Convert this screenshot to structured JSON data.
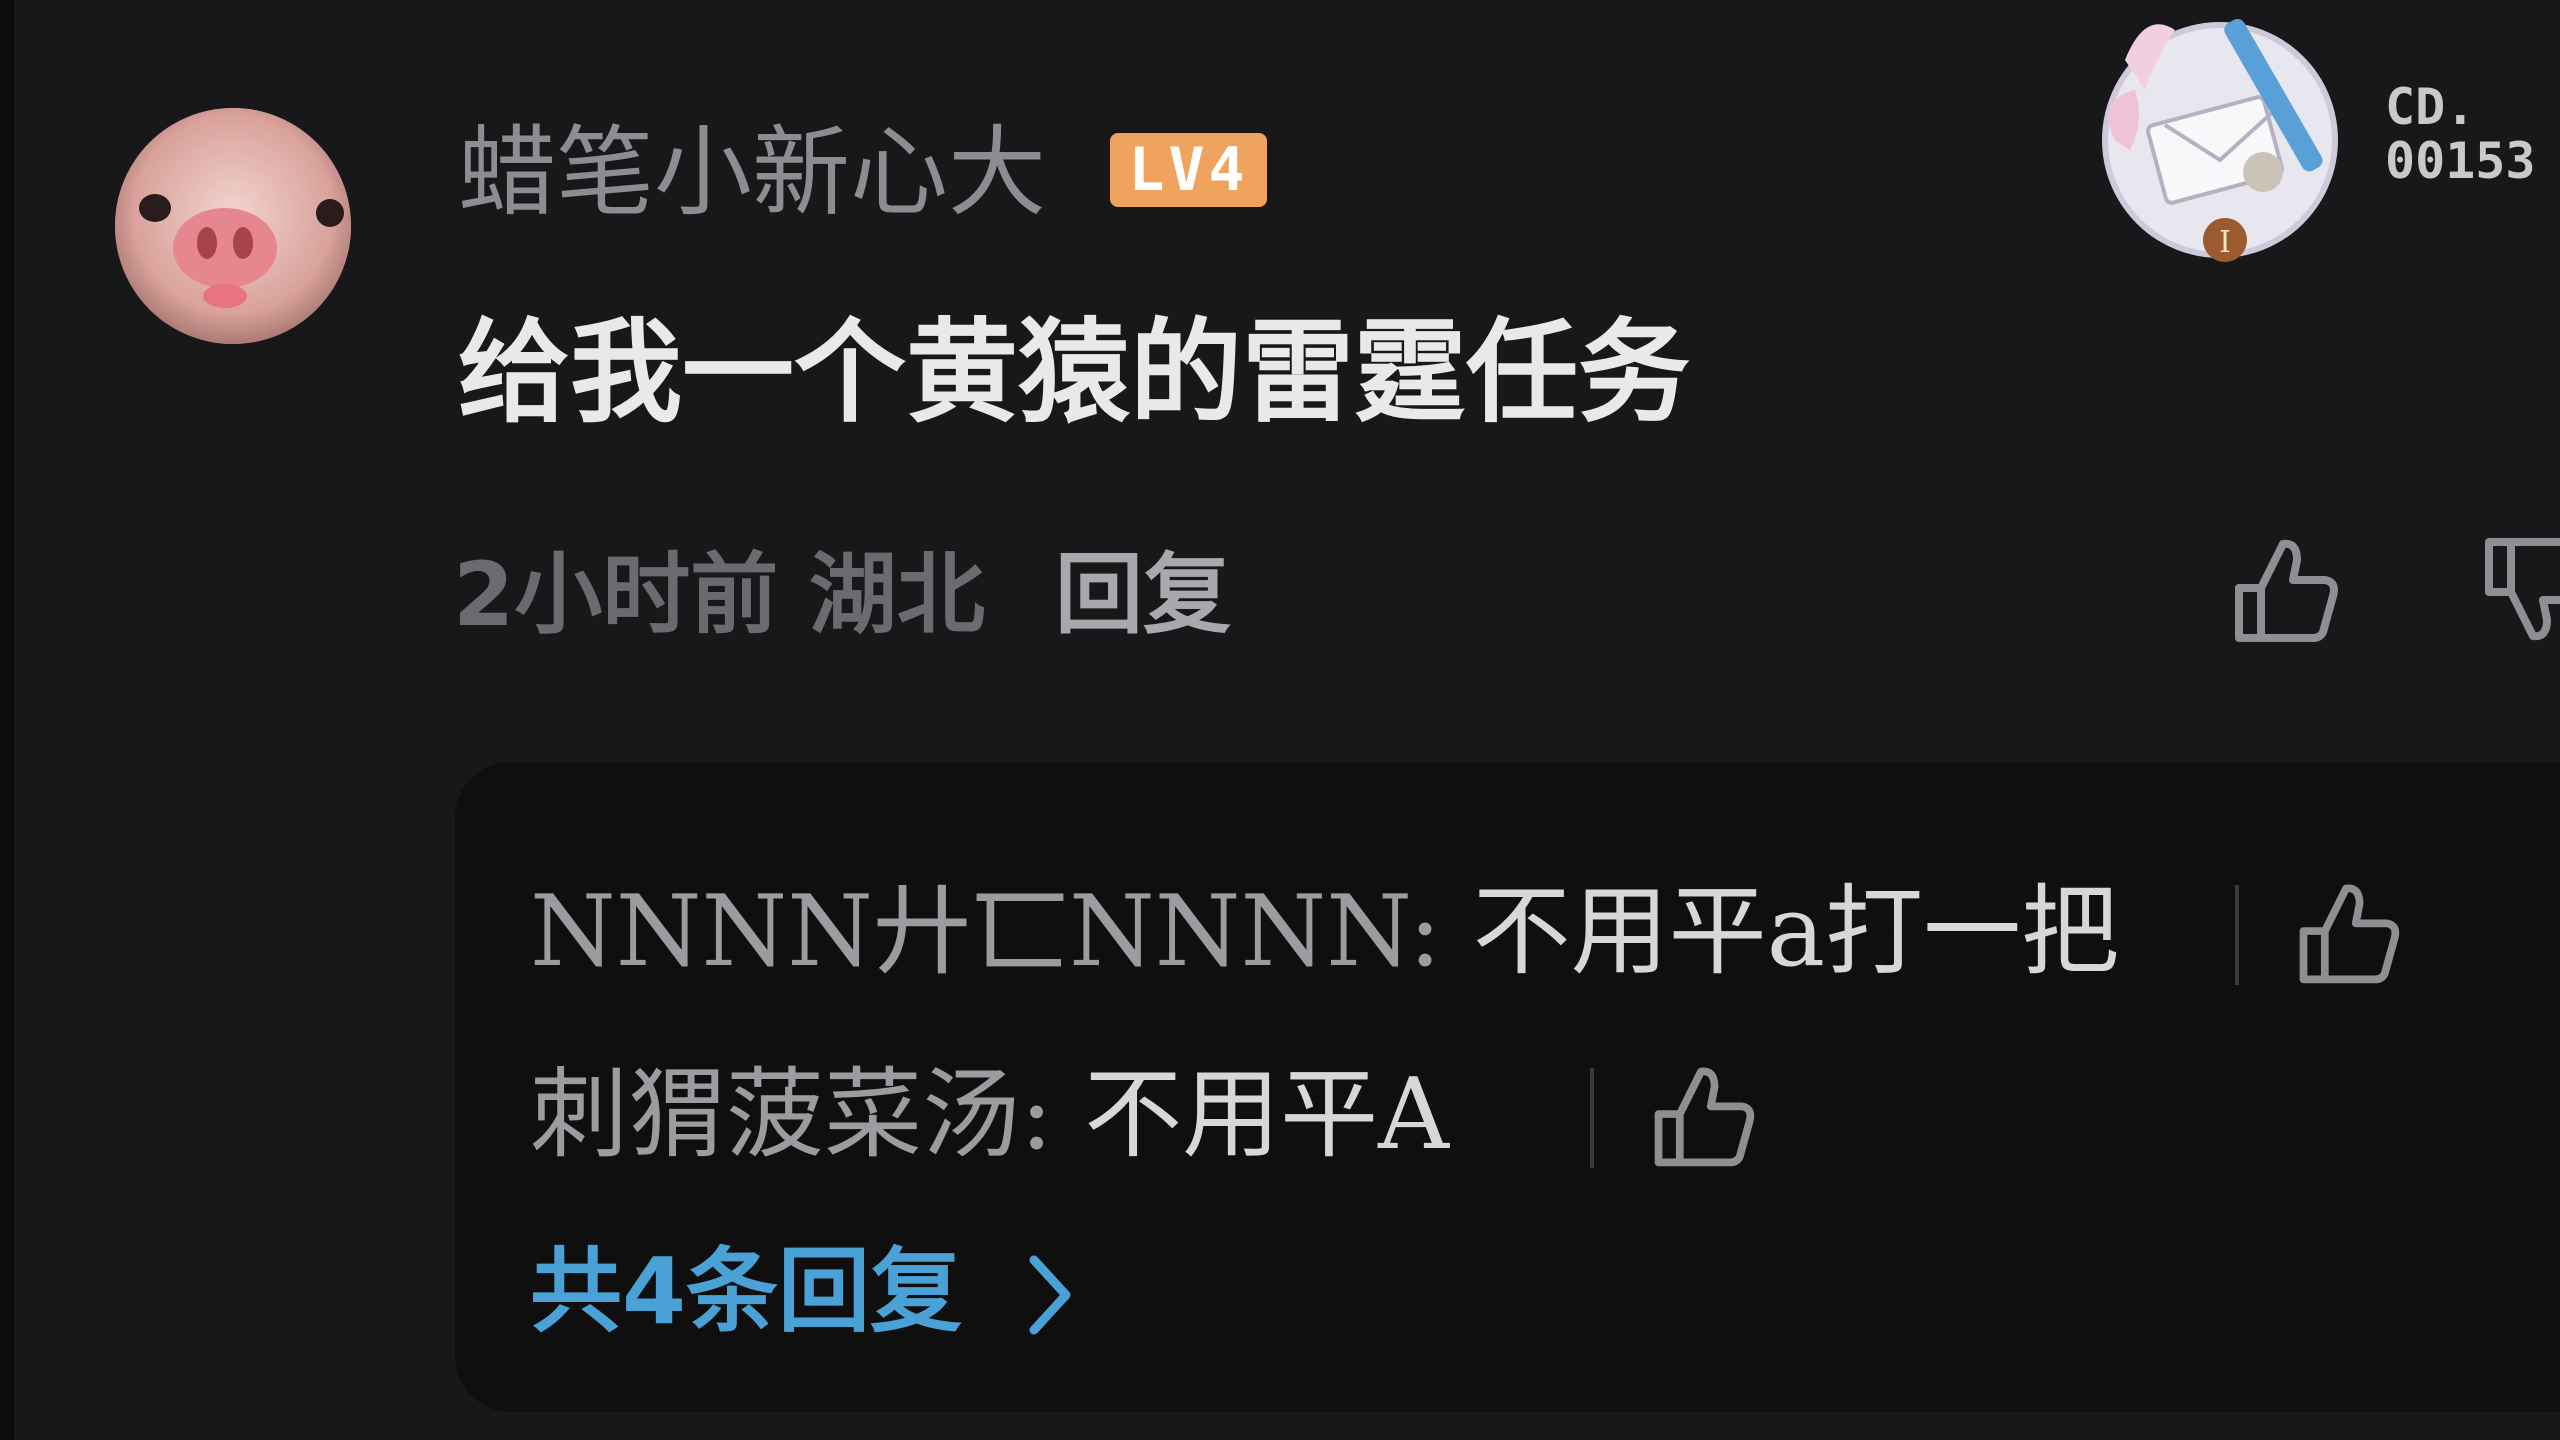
{
  "comment": {
    "username": "蜡笔小新心大",
    "level": "LV4",
    "text": "给我一个黄猿的雷霆任务",
    "time_location": "2小时前 湖北",
    "reply_label": "回复"
  },
  "decoration": {
    "text": "CD.\n00153"
  },
  "replies": [
    {
      "author": "NNNN廾匸NNNN:",
      "content": " 不用平a打一把"
    },
    {
      "author": "刺猬菠菜汤:",
      "content": " 不用平A"
    }
  ],
  "more_replies": "共4条回复",
  "colors": {
    "background": "#18181a",
    "reply_box": "#0f0f10",
    "level_badge": "#f0a35e",
    "link": "#4aa1d6"
  },
  "icons": [
    "avatar-pig",
    "thumb-up-icon",
    "thumb-down-icon",
    "chevron-right-icon",
    "decoration-badge"
  ]
}
